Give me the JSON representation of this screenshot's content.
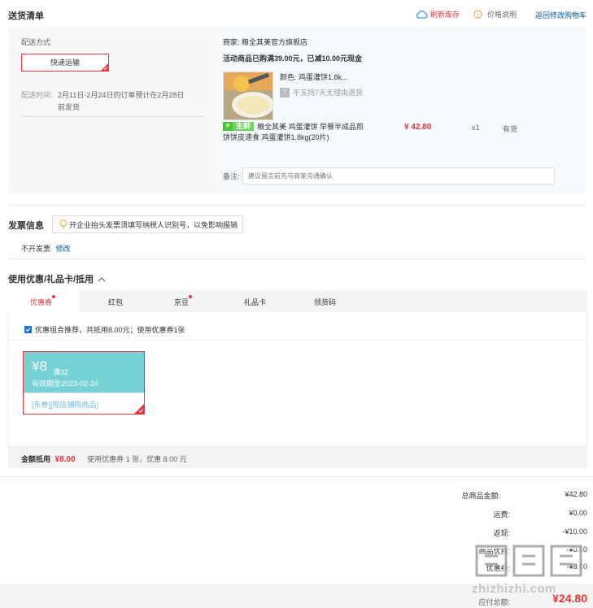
{
  "shipping": {
    "title": "送货清单",
    "refresh_stock": "刷新库存",
    "price_note": "价格说明",
    "back_to_cart": "返回修改购物车",
    "delivery_method_label": "配送方式",
    "delivery_method_value": "快递运输",
    "delivery_time_label": "配送时间:",
    "delivery_time_value": "2月11日-2月24日的订单预计在2月28日前发货",
    "merchant_label": "商家:",
    "merchant_name": "粮全其美官方旗舰店",
    "promo_text": "活动商品已购满39.00元，已减10.00元现金",
    "product": {
      "color_label": "颜色:",
      "color_value": "鸡蛋灌饼1.8k...",
      "no_return": "不支持7天无理由退货",
      "badge_text": "生鲜",
      "name": "粮全其美 鸡蛋灌饼 早餐半成品煎饼饼皮速食 鸡蛋灌饼1.8kg(20片)",
      "price": "¥ 42.80",
      "quantity": "x1",
      "stock": "有货"
    },
    "remark_label": "备注:",
    "remark_placeholder": "建议留言前先与商家沟通确认"
  },
  "invoice": {
    "title": "发票信息",
    "tip": "开企业抬头发票须填写纳税人识别号，以免影响报销",
    "value": "不开发票",
    "modify": "修改"
  },
  "coupons": {
    "title": "使用优惠/礼品卡/抵用",
    "tabs": [
      {
        "label": "优惠券",
        "dot": true
      },
      {
        "label": "红包",
        "dot": false
      },
      {
        "label": "京豆",
        "dot": true
      },
      {
        "label": "礼品卡",
        "dot": false
      },
      {
        "label": "领货码",
        "dot": false
      }
    ],
    "recommend_text": "优惠组合推荐，共抵用8.00元；使用优惠券1张",
    "coupon": {
      "amount": "¥8",
      "condition": "满32",
      "validity": "有效期至2023-02-24",
      "tag1": "[东券]",
      "tag2": "[限店铺限商品]"
    },
    "deduct_label": "金额抵用",
    "deduct_amount": "¥8.00",
    "deduct_detail": "使用优惠券 1 张，优惠 8.00 元"
  },
  "summary": {
    "rows": [
      {
        "label": "总商品金额:",
        "value": "¥42.80"
      },
      {
        "label": "运费:",
        "value": "¥0.00"
      },
      {
        "label": "返现:",
        "value": "-¥10.00"
      },
      {
        "label": "商品优惠:",
        "value": "-¥0.00"
      },
      {
        "label": "优惠券:",
        "value": "-¥8.00"
      }
    ],
    "total_label": "应付总额:",
    "total_value": "¥24.80"
  },
  "watermark": "值 什么值得买 zhizhizhi.com",
  "colors": {
    "accent": "#e4393c",
    "coupon_bg": "#74d2d4",
    "link": "#005aa0"
  }
}
